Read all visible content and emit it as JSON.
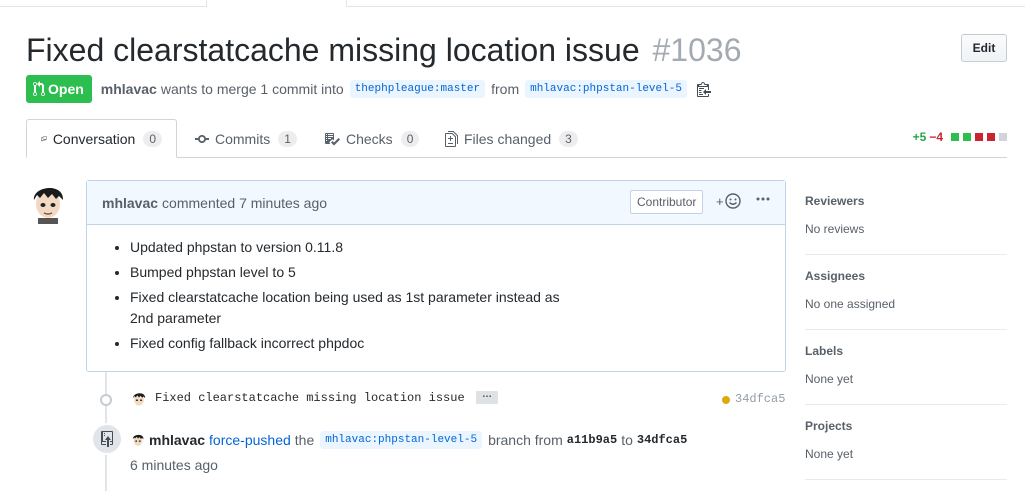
{
  "pr": {
    "title": "Fixed clearstatcache missing location issue",
    "number": "#1036",
    "edit_label": "Edit",
    "state": "Open",
    "author": "mhlavac",
    "merge_text": "wants to merge 1 commit into",
    "base_branch": "thephpleague:master",
    "from_text": "from",
    "head_branch": "mhlavac:phpstan-level-5"
  },
  "tabs": [
    {
      "label": "Conversation",
      "count": "0"
    },
    {
      "label": "Commits",
      "count": "1"
    },
    {
      "label": "Checks",
      "count": "0"
    },
    {
      "label": "Files changed",
      "count": "3"
    }
  ],
  "diffstat": {
    "additions": "+5",
    "deletions": "−4"
  },
  "comment": {
    "author": "mhlavac",
    "action": "commented 7 minutes ago",
    "role": "Contributor",
    "reaction_plus": "+",
    "items": [
      "Updated phpstan to version 0.11.8",
      "Bumped phpstan level to 5",
      "Fixed clearstatcache location being used as 1st parameter instead as 2nd parameter",
      "Fixed config fallback incorrect phpdoc"
    ]
  },
  "commit": {
    "message": "Fixed clearstatcache missing location issue",
    "ellipsis": "…",
    "sha": "34dfca5"
  },
  "push": {
    "author": "mhlavac",
    "action": "force-pushed",
    "the": "the",
    "branch": "mhlavac:phpstan-level-5",
    "branch_from": "branch from",
    "from_sha": "a11b9a5",
    "to": "to",
    "to_sha": "34dfca5",
    "time": "6 minutes ago"
  },
  "sidebar": [
    {
      "heading": "Reviewers",
      "value": "No reviews"
    },
    {
      "heading": "Assignees",
      "value": "No one assigned"
    },
    {
      "heading": "Labels",
      "value": "None yet"
    },
    {
      "heading": "Projects",
      "value": "None yet"
    }
  ],
  "colors": {
    "open_green": "#2cbe4e",
    "link_blue": "#0366d6",
    "add_green": "#28a745",
    "del_red": "#cb2431",
    "pending_yellow": "#dbab09"
  }
}
